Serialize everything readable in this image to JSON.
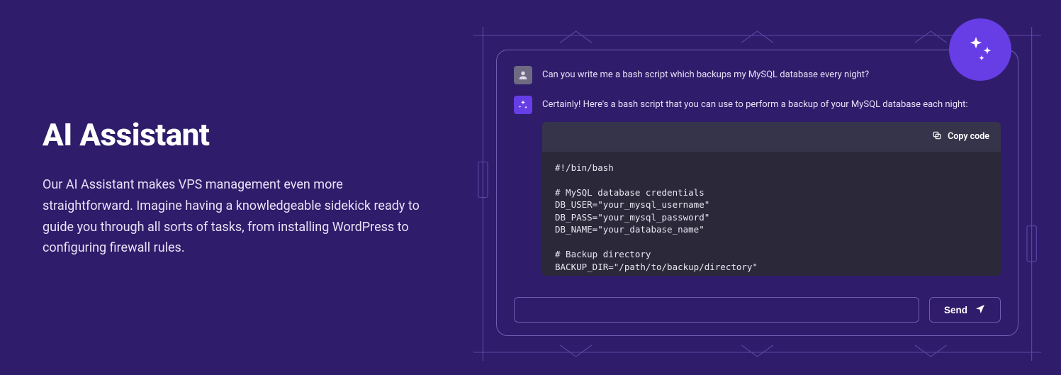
{
  "hero": {
    "title": "AI Assistant",
    "description": "Our AI Assistant makes VPS management even more straightforward. Imagine having a knowledgeable sidekick ready to guide you through all sorts of tasks, from installing WordPress to configuring firewall rules."
  },
  "chat": {
    "user_message": "Can you write me a bash script which backups my MySQL database every night?",
    "ai_message": "Certainly! Here's a bash script that you can use to perform a backup of your MySQL database each night:",
    "copy_label": "Copy code",
    "code": "#!/bin/bash\n\n# MySQL database credentials\nDB_USER=\"your_mysql_username\"\nDB_PASS=\"your_mysql_password\"\nDB_NAME=\"your_database_name\"\n\n# Backup directory\nBACKUP_DIR=\"/path/to/backup/directory\"\n\n# Date format for backup file",
    "send_label": "Send",
    "input_value": ""
  },
  "colors": {
    "accent": "#673de6",
    "outline": "#6e5fb3",
    "bg": "#2f1c6a"
  }
}
